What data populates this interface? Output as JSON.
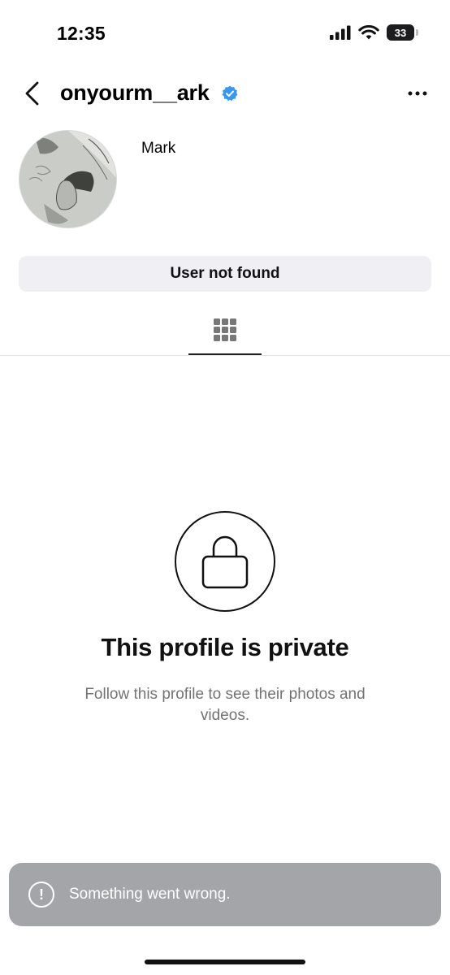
{
  "status_bar": {
    "time": "12:35",
    "battery_level": "33",
    "icons": [
      "cellular-signal-icon",
      "wifi-icon",
      "battery-icon"
    ]
  },
  "header": {
    "username": "onyourm__ark",
    "verified": true,
    "icons": [
      "back-chevron-icon",
      "verified-badge-icon",
      "more-options-icon"
    ]
  },
  "profile": {
    "display_name": "Mark",
    "action_button_label": "User not found"
  },
  "tabs": [
    {
      "icon": "grid-icon",
      "active": true
    }
  ],
  "private_notice": {
    "icon": "lock-icon",
    "title": "This profile is private",
    "subtitle": "Follow this profile to see their photos and videos."
  },
  "toast": {
    "icon": "alert-circle-icon",
    "message": "Something went wrong."
  },
  "colors": {
    "verified_blue": "#3897f0",
    "button_background": "#efeff4",
    "secondary_text": "#737373",
    "toast_background": "#a3a5a8"
  }
}
